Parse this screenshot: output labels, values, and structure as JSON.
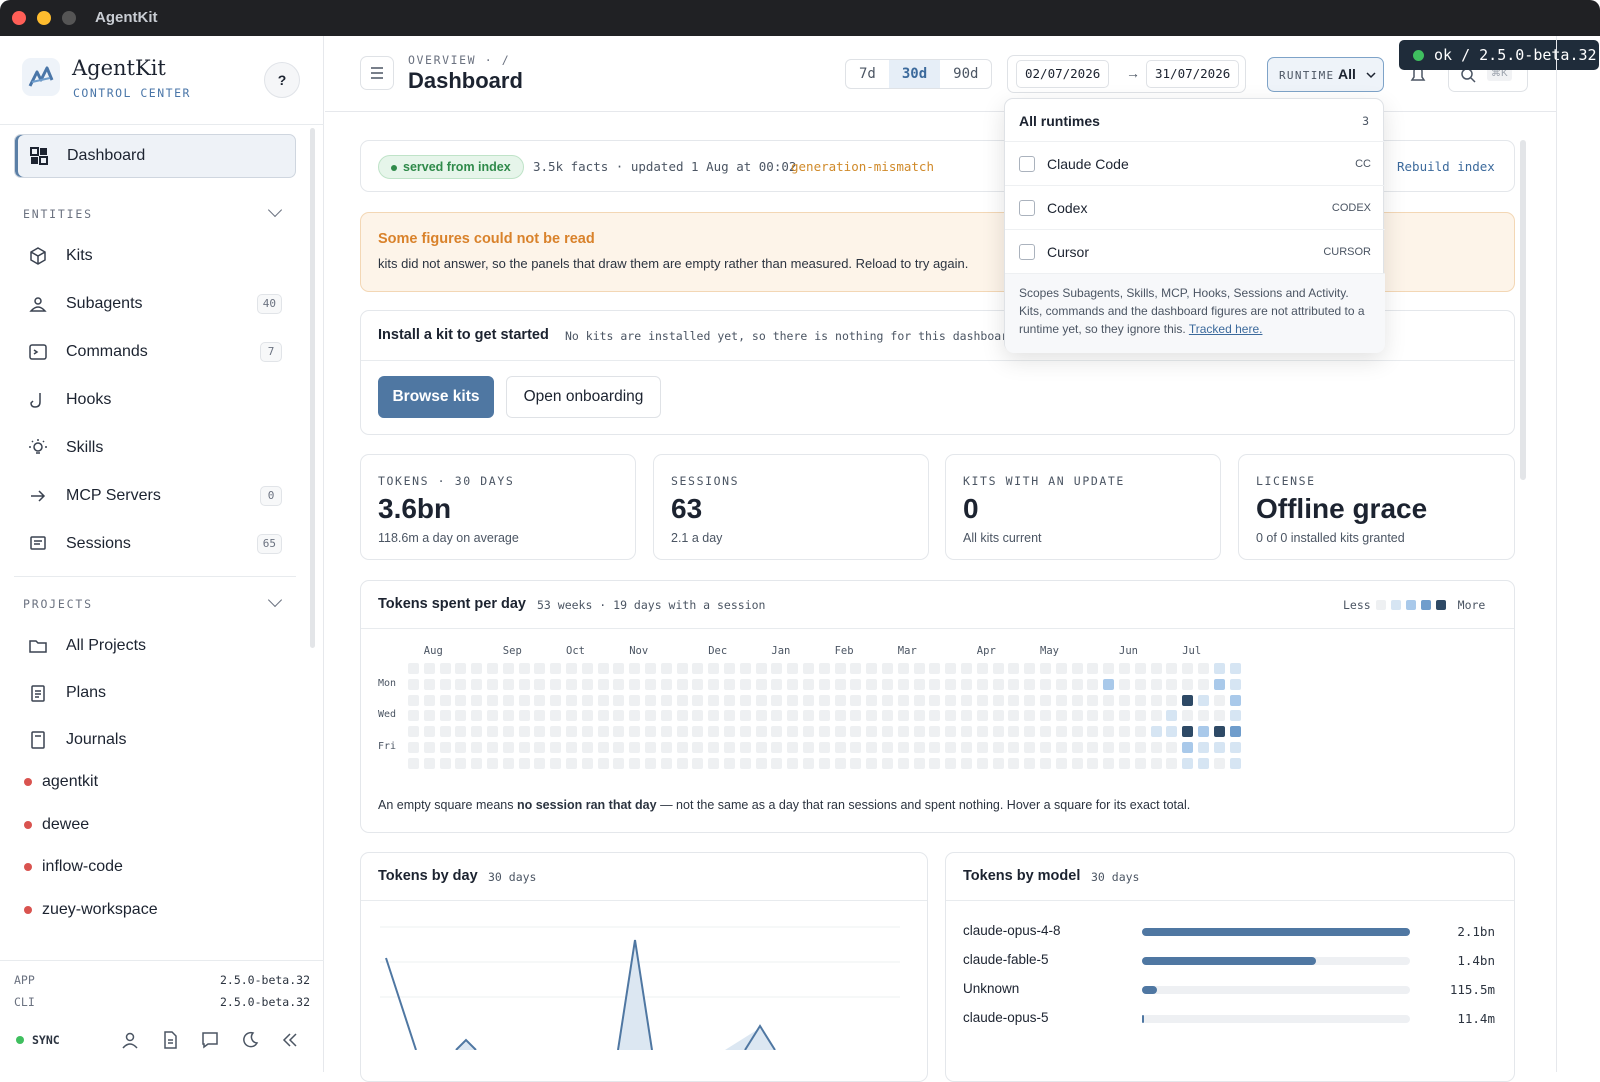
{
  "window": {
    "title": "AgentKit"
  },
  "brand": {
    "name": "AgentKit",
    "subtitle": "CONTROL CENTER",
    "help_label": "?"
  },
  "sidebar": {
    "primary": {
      "label": "Dashboard",
      "icon": "dashboard-icon"
    },
    "entities_label": "ENTITIES",
    "entities": [
      {
        "label": "Kits",
        "icon": "cube-icon",
        "count": null
      },
      {
        "label": "Subagents",
        "icon": "users-icon",
        "count": "40"
      },
      {
        "label": "Commands",
        "icon": "terminal-icon",
        "count": "7"
      },
      {
        "label": "Hooks",
        "icon": "hook-icon",
        "count": null
      },
      {
        "label": "Skills",
        "icon": "bulb-icon",
        "count": null
      },
      {
        "label": "MCP Servers",
        "icon": "arrow-right-icon",
        "count": "0"
      },
      {
        "label": "Sessions",
        "icon": "chat-icon",
        "count": "65"
      }
    ],
    "projects_label": "PROJECTS",
    "projects_nav": [
      {
        "label": "All Projects",
        "icon": "folder-icon"
      },
      {
        "label": "Plans",
        "icon": "clipboard-icon"
      },
      {
        "label": "Journals",
        "icon": "book-icon"
      }
    ],
    "projects": [
      "agentkit",
      "dewee",
      "inflow-code",
      "zuey-workspace"
    ],
    "footer": {
      "app_label": "APP",
      "app_version": "2.5.0-beta.32",
      "cli_label": "CLI",
      "cli_version": "2.5.0-beta.32",
      "sync_label": "SYNC"
    }
  },
  "header": {
    "breadcrumb": "OVERVIEW · /",
    "title": "Dashboard",
    "ranges": [
      "7d",
      "30d",
      "90d"
    ],
    "active_range": "30d",
    "date_from": "02/07/2026",
    "date_to": "31/07/2026",
    "runtime_label": "RUNTIME",
    "runtime_value": "All",
    "search_shortcut": "⌘K"
  },
  "toast": {
    "text": "ok / 2.5.0-beta.32"
  },
  "index_status": {
    "badge": "served from index",
    "facts": "3.5k facts · updated 1 Aug at 00:02",
    "warning": "generation-mismatch",
    "action": "Rebuild index"
  },
  "alert": {
    "title": "Some figures could not be read",
    "body": "kits did not answer, so the panels that draw them are empty rather than measured. Reload to try again."
  },
  "install": {
    "title": "Install a kit to get started",
    "note": "No kits are installed yet, so there is nothing for this dashboard",
    "primary_button": "Browse kits",
    "secondary_button": "Open onboarding"
  },
  "kpis": [
    {
      "label": "TOKENS · 30 DAYS",
      "value": "3.6bn",
      "sub": "118.6m a day on average"
    },
    {
      "label": "SESSIONS",
      "value": "63",
      "sub": "2.1 a day"
    },
    {
      "label": "KITS WITH AN UPDATE",
      "value": "0",
      "sub": "All kits current"
    },
    {
      "label": "LICENSE",
      "value": "Offline grace",
      "sub": "0 of 0 installed kits granted"
    }
  ],
  "heatmap": {
    "title": "Tokens spent per day",
    "meta": "53 weeks · 19 days with a session",
    "legend_less": "Less",
    "legend_more": "More",
    "months": [
      "Aug",
      "Sep",
      "Oct",
      "Nov",
      "Dec",
      "Jan",
      "Feb",
      "Mar",
      "Apr",
      "May",
      "Jun",
      "Jul"
    ],
    "day_labels": [
      "Mon",
      "Wed",
      "Fri"
    ],
    "colors": [
      "#eef0f2",
      "#d6e5f3",
      "#a9c9ea",
      "#6f9dcc",
      "#2e4a66"
    ],
    "active": [
      [
        44,
        1,
        2
      ],
      [
        47,
        4,
        1
      ],
      [
        48,
        3,
        1
      ],
      [
        48,
        4,
        1
      ],
      [
        49,
        2,
        4
      ],
      [
        49,
        4,
        4
      ],
      [
        49,
        5,
        2
      ],
      [
        49,
        6,
        1
      ],
      [
        50,
        2,
        1
      ],
      [
        50,
        4,
        2
      ],
      [
        50,
        5,
        1
      ],
      [
        50,
        6,
        1
      ],
      [
        51,
        0,
        1
      ],
      [
        51,
        1,
        2
      ],
      [
        51,
        4,
        4
      ],
      [
        51,
        5,
        1
      ],
      [
        52,
        0,
        1
      ],
      [
        52,
        1,
        1
      ],
      [
        52,
        2,
        2
      ],
      [
        52,
        3,
        1
      ],
      [
        52,
        4,
        3
      ],
      [
        52,
        5,
        1
      ],
      [
        52,
        6,
        1
      ]
    ],
    "footnote_pre": "An empty square means ",
    "footnote_bold": "no session ran that day",
    "footnote_post": " — not the same as a day that ran sessions and spent nothing. Hover a square for its exact total."
  },
  "tokens_by_day": {
    "title": "Tokens by day",
    "meta": "30 days"
  },
  "tokens_by_model": {
    "title": "Tokens by model",
    "meta": "30 days",
    "rows": [
      {
        "name": "claude-opus-4-8",
        "value": "2.1bn",
        "fraction": 1.0
      },
      {
        "name": "claude-fable-5",
        "value": "1.4bn",
        "fraction": 0.65
      },
      {
        "name": "Unknown",
        "value": "115.5m",
        "fraction": 0.055
      },
      {
        "name": "claude-opus-5",
        "value": "11.4m",
        "fraction": 0.006
      }
    ]
  },
  "runtime_dropdown": {
    "header": "All runtimes",
    "count": "3",
    "options": [
      {
        "label": "Claude Code",
        "code": "CC"
      },
      {
        "label": "Codex",
        "code": "CODEX"
      },
      {
        "label": "Cursor",
        "code": "CURSOR"
      }
    ],
    "note": "Scopes Subagents, Skills, MCP, Hooks, Sessions and Activity. Kits, commands and the dashboard figures are not attributed to a runtime yet, so they ignore this.",
    "link": "Tracked here."
  }
}
